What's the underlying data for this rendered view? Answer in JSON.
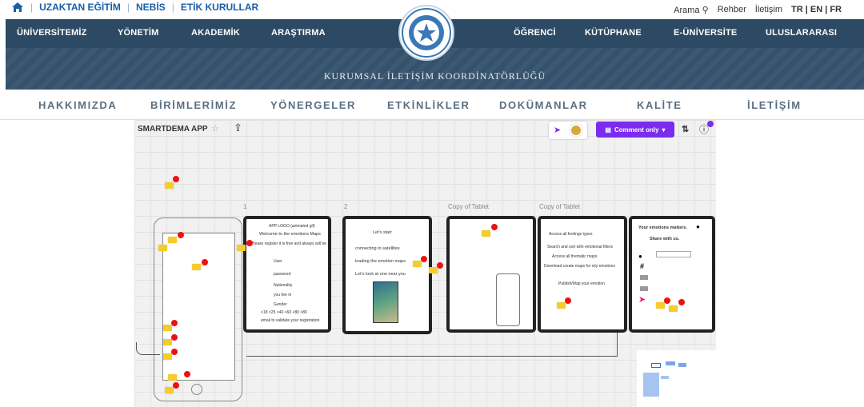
{
  "topbar": {
    "links": [
      "UZAKTAN EĞİTİM",
      "NEBİS",
      "ETİK KURULLAR"
    ],
    "search_label": "Arama",
    "right_links": [
      "Rehber",
      "İletişim"
    ],
    "languages": "TR | EN | FR"
  },
  "mainnav": {
    "left": [
      "ÜNİVERSİTEMİZ",
      "YÖNETİM",
      "AKADEMİK",
      "ARAŞTIRMA"
    ],
    "right": [
      "ÖĞRENCİ",
      "KÜTÜPHANE",
      "E-ÜNİVERSİTE",
      "ULUSLARARASI"
    ]
  },
  "banner": {
    "title": "KURUMSAL İLETİŞİM KOORDİNATÖRLÜĞÜ"
  },
  "subnav": [
    "HAKKIMIZDA",
    "BİRİMLERİMİZ",
    "YÖNERGELER",
    "ETKİNLİKLER",
    "DOKÜMANLAR",
    "KALİTE",
    "İLETİŞİM"
  ],
  "board": {
    "title": "SMARTDEMA APP",
    "comment_button": "Comment only",
    "frame_labels": [
      "1",
      "2",
      "Copy of Tablet",
      "Copy of Tablet"
    ],
    "frame1_lines": [
      "APP LOGO (animated gif)",
      "Welcome to the emotions Maps",
      "Please register it is free and always will be",
      "User",
      "password",
      "Nationality",
      "you live in",
      "Gender",
      "<18  <25  <40  <60  <80  >80",
      "email to validate your registration"
    ],
    "frame2_lines": [
      "Let's start",
      "connecting to satellites",
      "loading the emotion maps",
      "Let's look at one near you"
    ],
    "frame4_lines": [
      "Access all feelings types",
      "Search and sort with emotional filters",
      "Access all thematic maps",
      "Download create maps for city emotions",
      "Publish/Map your emotion"
    ],
    "frame5_lines": [
      "Your emotions matters.",
      "Share with us."
    ]
  },
  "colors": {
    "nav": "#2c4a63",
    "banner": "#34526b",
    "accent": "#7b2cf0",
    "link": "#1a5ea8",
    "sticky": "#f6cc2c"
  }
}
